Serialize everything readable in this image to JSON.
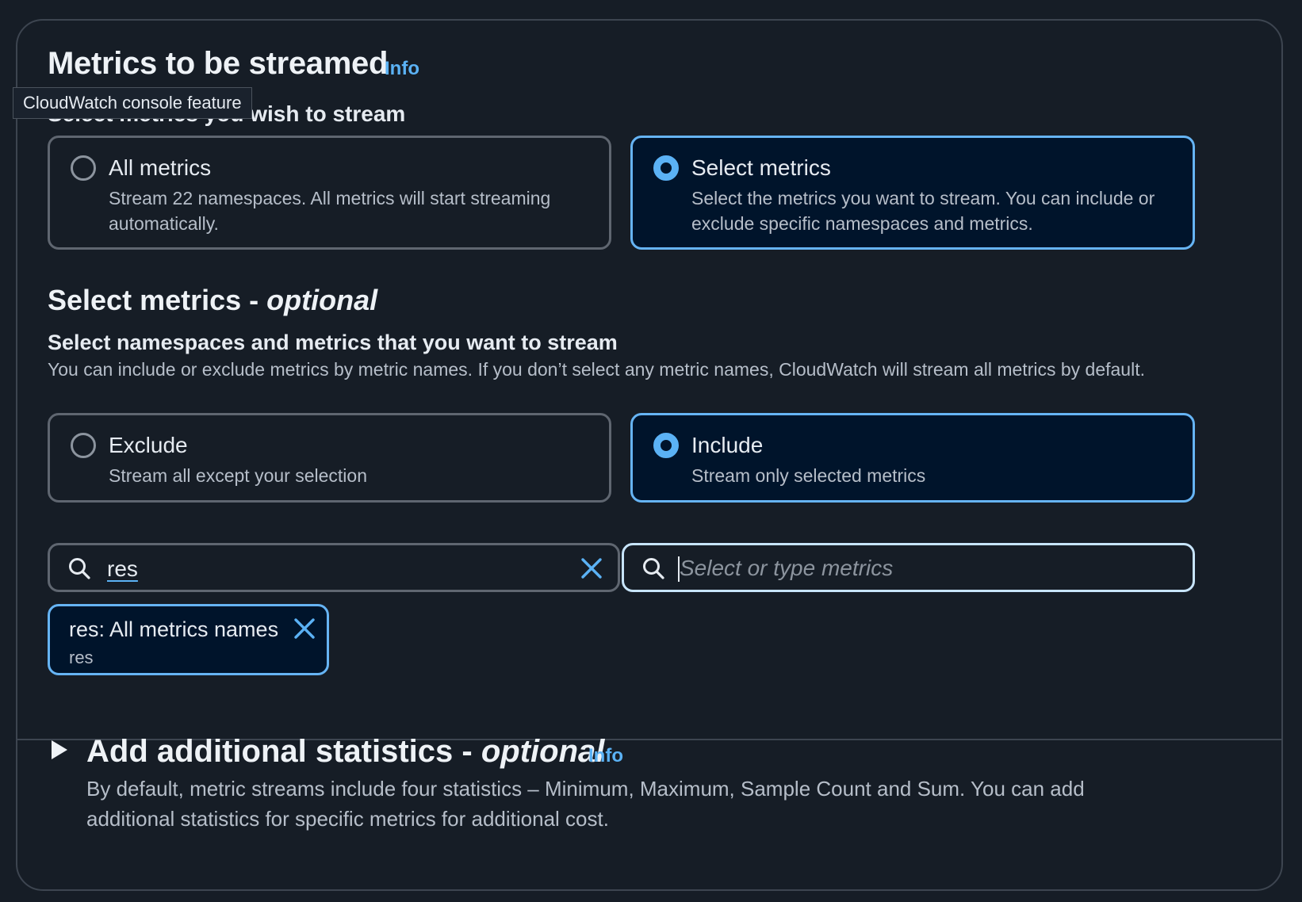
{
  "section": {
    "title": "Metrics to be streamed",
    "info_link": "Info",
    "tooltip": "CloudWatch console feature",
    "prompt": "Select metrics you wish to stream"
  },
  "stream_mode": {
    "options": [
      {
        "title": "All metrics",
        "description": "Stream 22 namespaces. All metrics will start streaming automatically.",
        "selected": false
      },
      {
        "title": "Select metrics",
        "description": "Select the metrics you want to stream. You can include or exclude specific namespaces and metrics.",
        "selected": true
      }
    ]
  },
  "select_metrics": {
    "heading": "Select metrics - ",
    "heading_optional": "optional",
    "label": "Select namespaces and metrics that you want to stream",
    "description": "You can include or exclude metrics by metric names. If you don’t select any metric names, CloudWatch will stream all metrics by default."
  },
  "filter_mode": {
    "options": [
      {
        "title": "Exclude",
        "description": "Stream all except your selection",
        "selected": false
      },
      {
        "title": "Include",
        "description": "Stream only selected metrics",
        "selected": true
      }
    ]
  },
  "namespace_search": {
    "value": "res"
  },
  "metrics_search": {
    "placeholder": "Select or type metrics"
  },
  "tokens": [
    {
      "label": "res: All metrics names",
      "sublabel": "res"
    }
  ],
  "additional_stats": {
    "heading": "Add additional statistics - ",
    "heading_optional": "optional",
    "info_link": "Info",
    "description": "By default, metric streams include four statistics – Minimum, Maximum, Sample Count and Sum. You can add additional statistics for specific metrics for additional cost."
  },
  "colors": {
    "accent": "#5bb2f5",
    "background": "#161d26",
    "selected_bg": "#00142b"
  }
}
